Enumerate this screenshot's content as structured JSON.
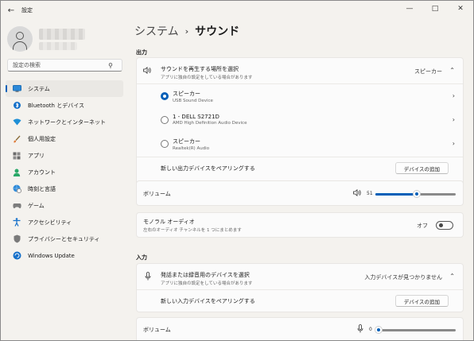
{
  "app": {
    "title": "設定"
  },
  "search": {
    "placeholder": "設定の検索"
  },
  "nav": {
    "items": [
      {
        "label": "システム",
        "icon": "monitor-icon",
        "selected": true
      },
      {
        "label": "Bluetooth とデバイス",
        "icon": "bluetooth-icon"
      },
      {
        "label": "ネットワークとインターネット",
        "icon": "wifi-icon"
      },
      {
        "label": "個人用設定",
        "icon": "brush-icon"
      },
      {
        "label": "アプリ",
        "icon": "apps-icon"
      },
      {
        "label": "アカウント",
        "icon": "account-icon"
      },
      {
        "label": "時刻と言語",
        "icon": "globe-clock-icon"
      },
      {
        "label": "ゲーム",
        "icon": "gamepad-icon"
      },
      {
        "label": "アクセシビリティ",
        "icon": "accessibility-icon"
      },
      {
        "label": "プライバシーとセキュリティ",
        "icon": "shield-icon"
      },
      {
        "label": "Windows Update",
        "icon": "update-icon"
      }
    ]
  },
  "breadcrumb": {
    "parent": "システム",
    "separator": "›",
    "current": "サウンド"
  },
  "output": {
    "section_title": "出力",
    "select_title": "サウンドを再生する場所を選択",
    "select_sub": "アプリに独自の設定をしている場合があります",
    "select_value": "スピーカー",
    "devices": [
      {
        "name": "スピーカー",
        "sub": "USB Sound Device",
        "checked": true
      },
      {
        "name": "1 - DELL S2721D",
        "sub": "AMD High Definition Audio Device",
        "checked": false
      },
      {
        "name": "スピーカー",
        "sub": "Realtek(R) Audio",
        "checked": false
      }
    ],
    "pair_label": "新しい出力デバイスをペアリングする",
    "add_button": "デバイスの追加",
    "volume_label": "ボリューム",
    "volume_value": "51",
    "volume_fraction": 0.51,
    "mono_title": "モノラル オーディオ",
    "mono_sub": "左右のオーディオ チャンネルを 1 つにまとめます",
    "mono_state": "オフ"
  },
  "input": {
    "section_title": "入力",
    "select_title": "発話または録音用のデバイスを選択",
    "select_sub": "アプリに独自の設定をしている場合があります",
    "select_value": "入力デバイスが見つかりません",
    "pair_label": "新しい入力デバイスをペアリングする",
    "add_button": "デバイスの追加",
    "volume_label": "ボリューム",
    "volume_value": "0",
    "volume_fraction": 0
  },
  "colors": {
    "accent": "#005fb8"
  }
}
